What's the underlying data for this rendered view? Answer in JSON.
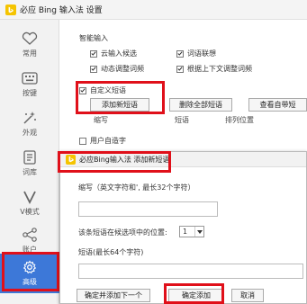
{
  "window": {
    "title": "必应 Bing 输入法 设置"
  },
  "sidebar": {
    "items": [
      {
        "label": "常用",
        "icon": "heart-icon"
      },
      {
        "label": "按键",
        "icon": "keyboard-icon"
      },
      {
        "label": "外观",
        "icon": "magic-wand-icon"
      },
      {
        "label": "词库",
        "icon": "book-icon"
      },
      {
        "label": "V模式",
        "icon": "v-icon"
      },
      {
        "label": "账户",
        "icon": "share-icon"
      },
      {
        "label": "高级",
        "icon": "gear-icon"
      }
    ],
    "active": "高级"
  },
  "main": {
    "smart_input_label": "智能输入",
    "checkboxes": [
      {
        "label": "云输入候选",
        "checked": true
      },
      {
        "label": "词语联想",
        "checked": true
      },
      {
        "label": "动态调整词频",
        "checked": true
      },
      {
        "label": "根据上下文调整词频",
        "checked": true
      }
    ],
    "custom_phrase": {
      "label": "自定义短语",
      "checked": true
    },
    "buttons": {
      "add_new": "添加新短语",
      "delete_all": "删除全部短语",
      "view_all": "查看自带短"
    },
    "columns": [
      "缩写",
      "短语",
      "排列位置"
    ],
    "user_defined": {
      "label": "用户自造字",
      "checked": false
    }
  },
  "dialog": {
    "title": "必应Bing输入法 添加新短语",
    "abbr_label": "缩写（英文字符和', 最长32个字符）",
    "position_label": "该条短语在候选项中的位置:",
    "position_value": "1",
    "phrase_label": "短语(最长64个字符)",
    "buttons": {
      "confirm_next": "确定并添加下一个",
      "confirm_add": "确定添加",
      "cancel": "取消"
    }
  },
  "colors": {
    "accent": "#3d78d8",
    "highlight": "#e0101a",
    "logo": "#f5c400"
  }
}
